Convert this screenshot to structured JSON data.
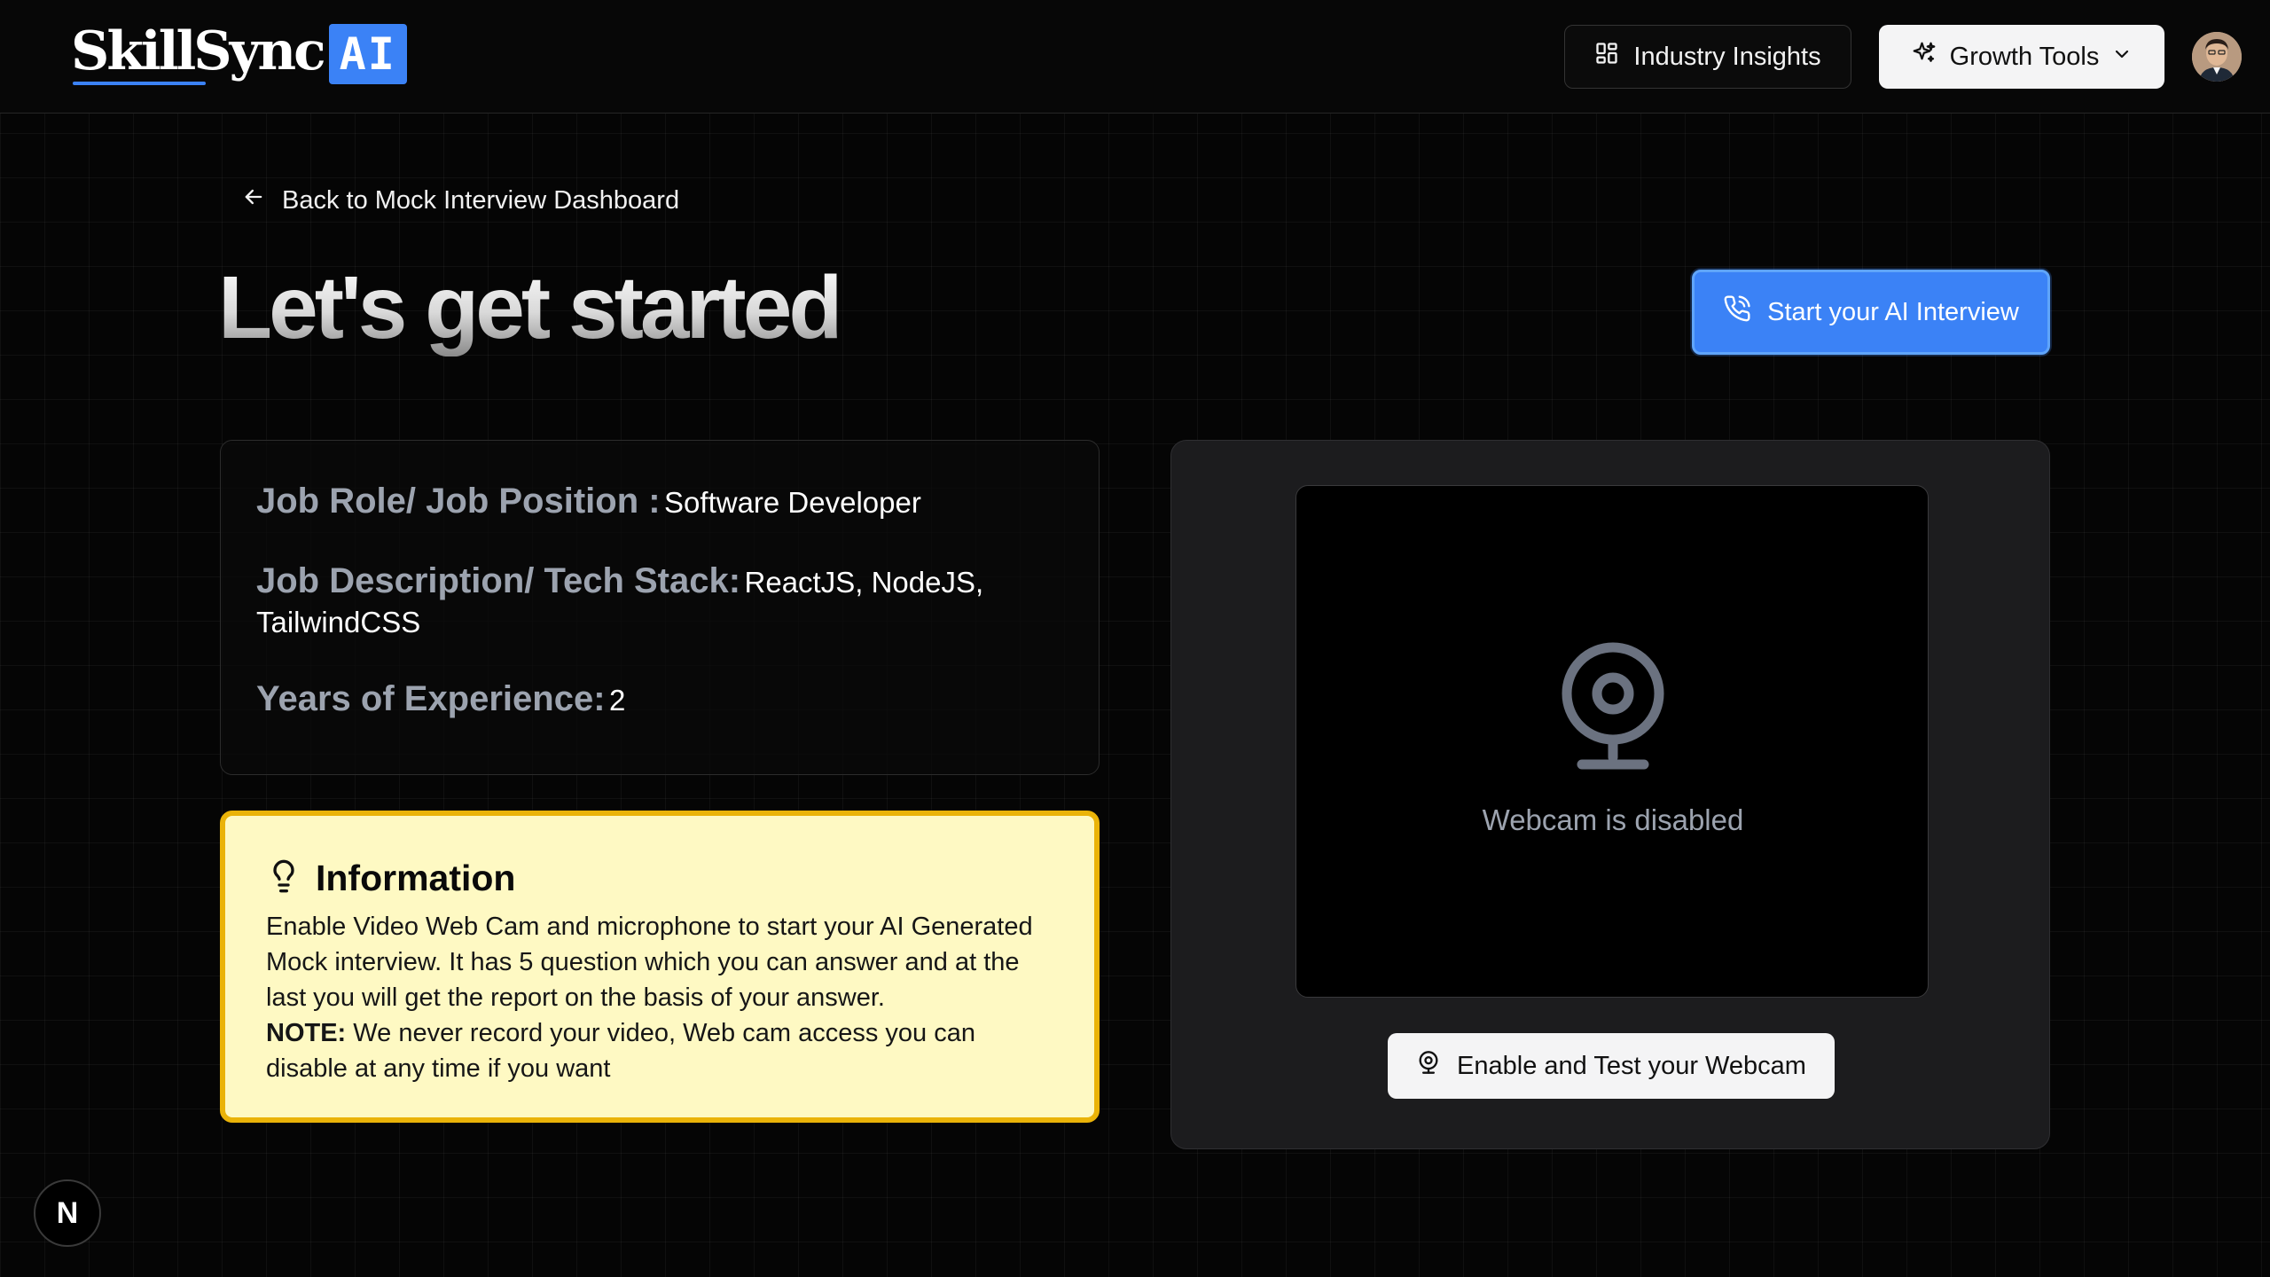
{
  "header": {
    "logo": {
      "word": "SkillSync",
      "badge": "AI"
    },
    "insights_label": "Industry Insights",
    "growth_label": "Growth Tools"
  },
  "main": {
    "back_label": "Back to Mock Interview Dashboard",
    "title": "Let's get started",
    "start_button_label": "Start your AI Interview"
  },
  "job": {
    "role_label": "Job Role/ Job Position :",
    "role_value": "Software Developer",
    "desc_label": "Job Description/ Tech Stack:",
    "desc_value": "ReactJS, NodeJS, TailwindCSS",
    "exp_label": "Years of Experience:",
    "exp_value": "2"
  },
  "info": {
    "title": "Information",
    "body": "Enable Video Web Cam and microphone to start your AI Generated Mock interview. It has 5 question which you can answer and at the last you will get the report on the basis of your answer.",
    "note_label": "NOTE:",
    "note_text": "We never record your video, Web cam access you can disable at any time if you want"
  },
  "webcam": {
    "status_text": "Webcam is disabled",
    "enable_button_label": "Enable and Test your Webcam"
  },
  "dev_badge": {
    "letter": "N"
  },
  "colors": {
    "accent": "#3b82f6",
    "info_bg": "#fef9c3",
    "info_border": "#eab308",
    "page_bg": "#050505"
  },
  "icons": {
    "insights": "grid-icon",
    "growth": "sparkles-icon",
    "growth_dropdown": "chevron-down-icon",
    "back": "arrow-left-icon",
    "start": "phone-call-icon",
    "info": "lightbulb-icon",
    "webcam_placeholder": "webcam-icon",
    "webcam_button": "webcam-icon"
  }
}
